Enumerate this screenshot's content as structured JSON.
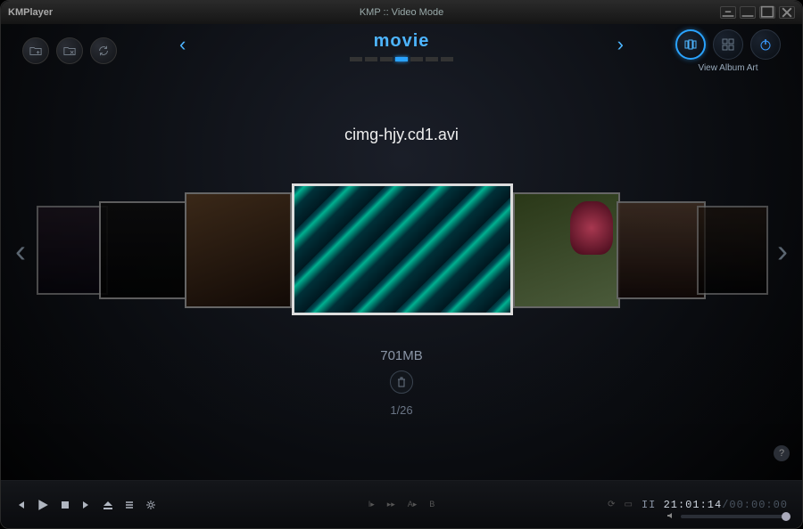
{
  "app_name": "KMPlayer",
  "window_title": "KMP :: Video Mode",
  "category": {
    "title": "movie",
    "dot_count": 7,
    "active_dot": 3
  },
  "view_mode": {
    "label": "View Album Art"
  },
  "current_item": {
    "filename": "cimg-hjy.cd1.avi",
    "filesize": "701MB",
    "index_display": "1/26"
  },
  "time": {
    "status_glyph": "II",
    "current": "21:01:14",
    "total": "00:00:00"
  },
  "center_controls": {
    "quick_back": "I▸",
    "quick_fwd": "▸▸",
    "ab_a": "A▸",
    "ab_b": "B"
  },
  "icons": {
    "help": "?"
  }
}
